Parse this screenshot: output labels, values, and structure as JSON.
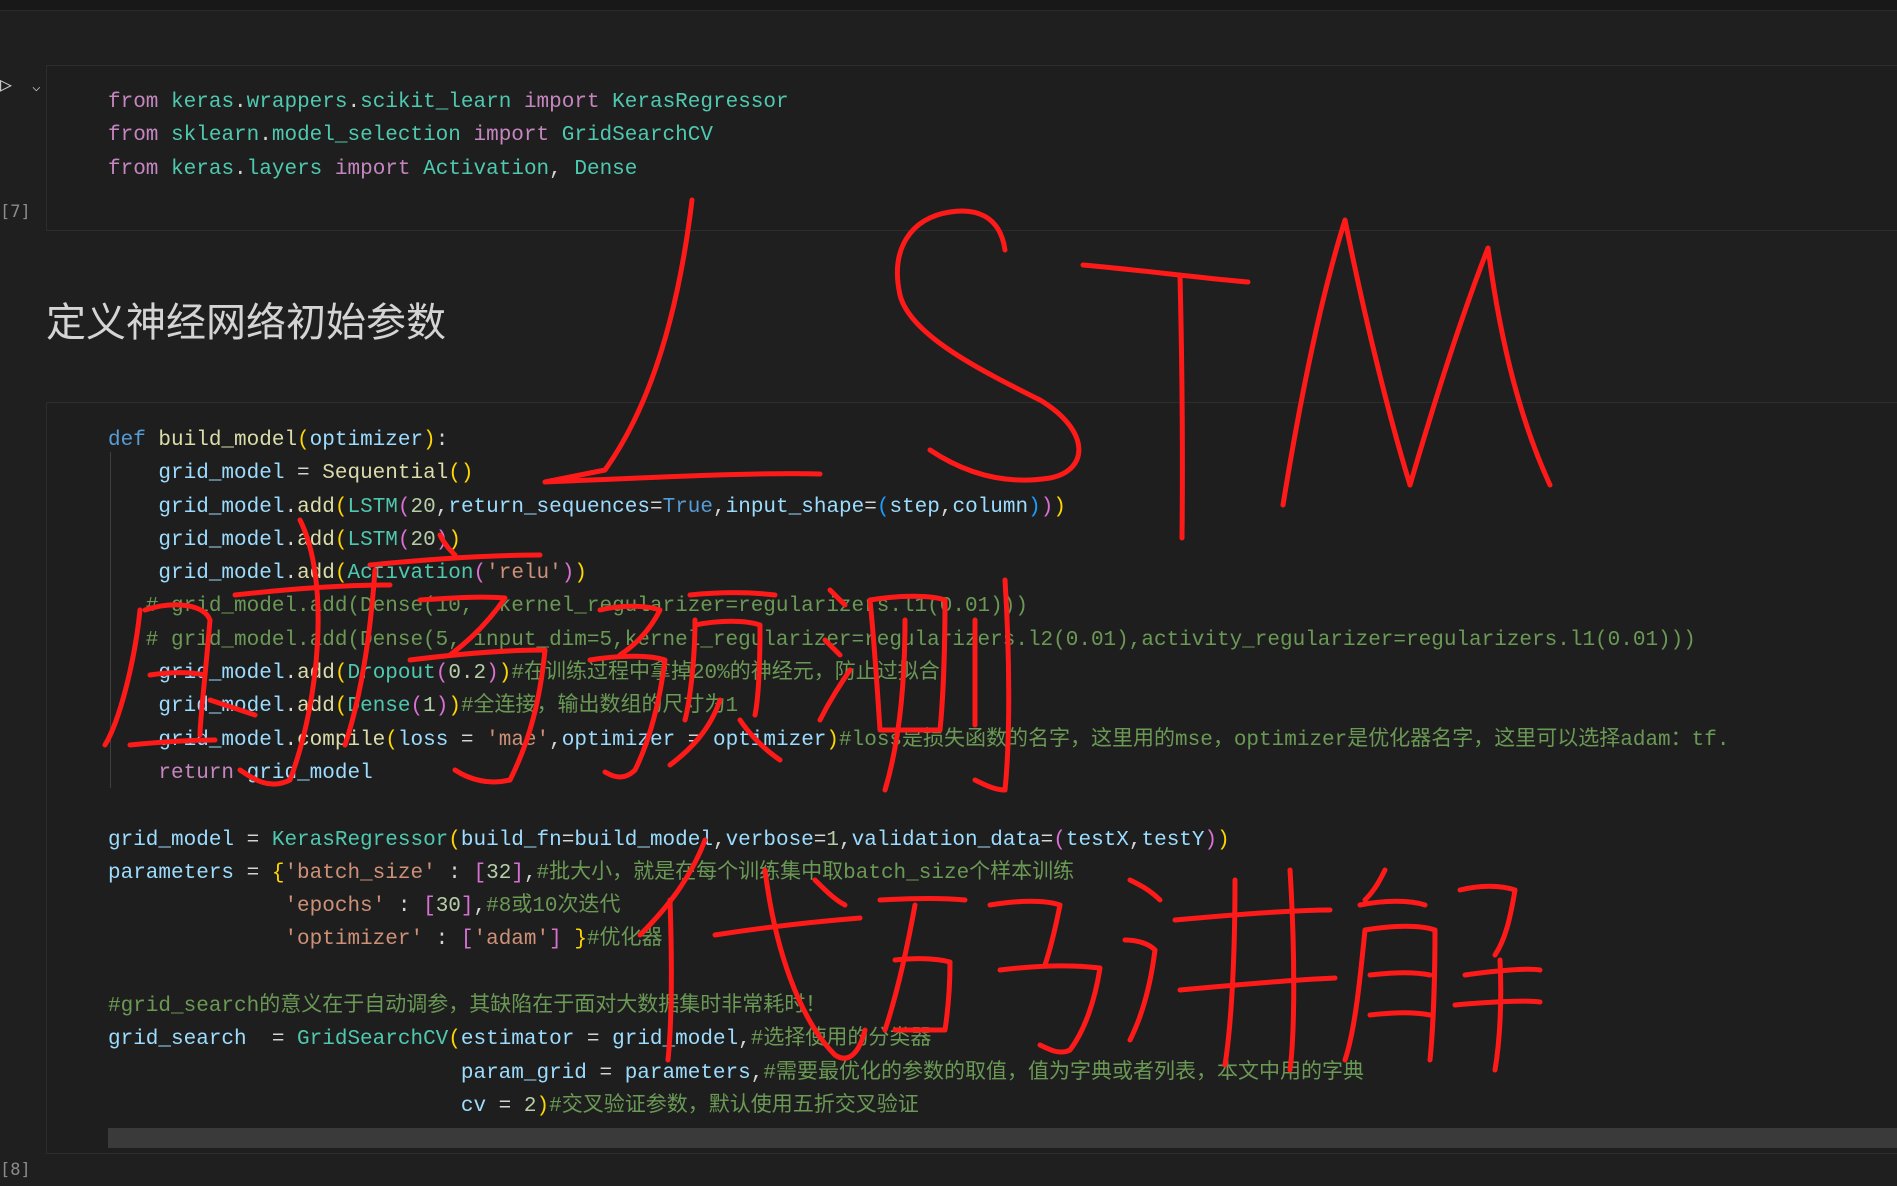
{
  "cell1": {
    "exec_count": "[7]",
    "lines": [
      "from keras.wrappers.scikit_learn import KerasRegressor",
      "from sklearn.model_selection import GridSearchCV",
      "from keras.layers import Activation, Dense"
    ]
  },
  "markdown": {
    "heading": "定义神经网络初始参数"
  },
  "cell2": {
    "exec_count": "[8]",
    "lines": [
      "def build_model(optimizer):",
      "    grid_model = Sequential()",
      "    grid_model.add(LSTM(20,return_sequences=True,input_shape=(step,column)))",
      "    grid_model.add(LSTM(20))",
      "    grid_model.add(Activation('relu'))",
      "   # grid_model.add(Dense(10,  kernel_regularizer=regularizers.l1(0.01)))",
      "   # grid_model.add(Dense(5, input_dim=5,kernel_regularizer=regularizers.l2(0.01),activity_regularizer=regularizers.l1(0.01)))",
      "    grid_model.add(Dropout(0.2))#在训练过程中拿掉20%的神经元，防止过拟合",
      "    grid_model.add(Dense(1))#全连接，输出数组的尺寸为1",
      "    grid_model.compile(loss = 'mae',optimizer = optimizer)#loss是损失函数的名字，这里用的mse，optimizer是优化器名字，这里可以选择adam：tf.",
      "    return grid_model",
      "",
      "grid_model = KerasRegressor(build_fn=build_model,verbose=1,validation_data=(testX,testY))",
      "parameters = {'batch_size' : [32],#批大小，就是在每个训练集中取batch_size个样本训练",
      "              'epochs' : [30],#8或10次迭代",
      "              'optimizer' : ['adam'] }#优化器",
      "",
      "#grid_search的意义在于自动调参，其缺陷在于面对大数据集时非常耗时！",
      "grid_search  = GridSearchCV(estimator = grid_model,#选择使用的分类器",
      "                            param_grid = parameters,#需要最优化的参数的取值，值为字典或者列表，本文中用的字典",
      "                            cv = 2)#交叉验证参数，默认使用五折交叉验证"
    ]
  },
  "annotation": {
    "color": "#ff1a1a"
  }
}
